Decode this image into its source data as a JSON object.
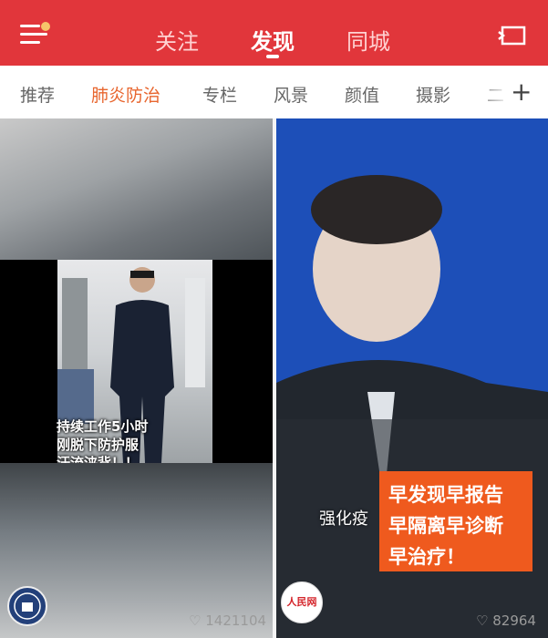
{
  "header": {
    "tabs": [
      {
        "label": "关注"
      },
      {
        "label": "发现"
      },
      {
        "label": "同城"
      }
    ]
  },
  "categories": {
    "items": [
      {
        "label": "推荐"
      },
      {
        "label": "肺炎防治"
      },
      {
        "label": "专栏"
      },
      {
        "label": "风景"
      },
      {
        "label": "颜值"
      },
      {
        "label": "摄影"
      },
      {
        "label": "二"
      }
    ],
    "plus": "+"
  },
  "cards": {
    "left": {
      "caption_lines": [
        "持续工作5小时",
        "刚脱下防护服",
        "汗流浃背！！"
      ],
      "likes": "1421104"
    },
    "right": {
      "overlay": "强化疫",
      "box_lines": [
        "早发现早报告",
        "早隔离早诊断",
        "早治疗！"
      ],
      "logo": "人民网",
      "likes": "82964"
    }
  },
  "colors": {
    "header_red": "#e1363b",
    "active_category": "#e8662f",
    "orange_box": "#ef5a1e"
  }
}
